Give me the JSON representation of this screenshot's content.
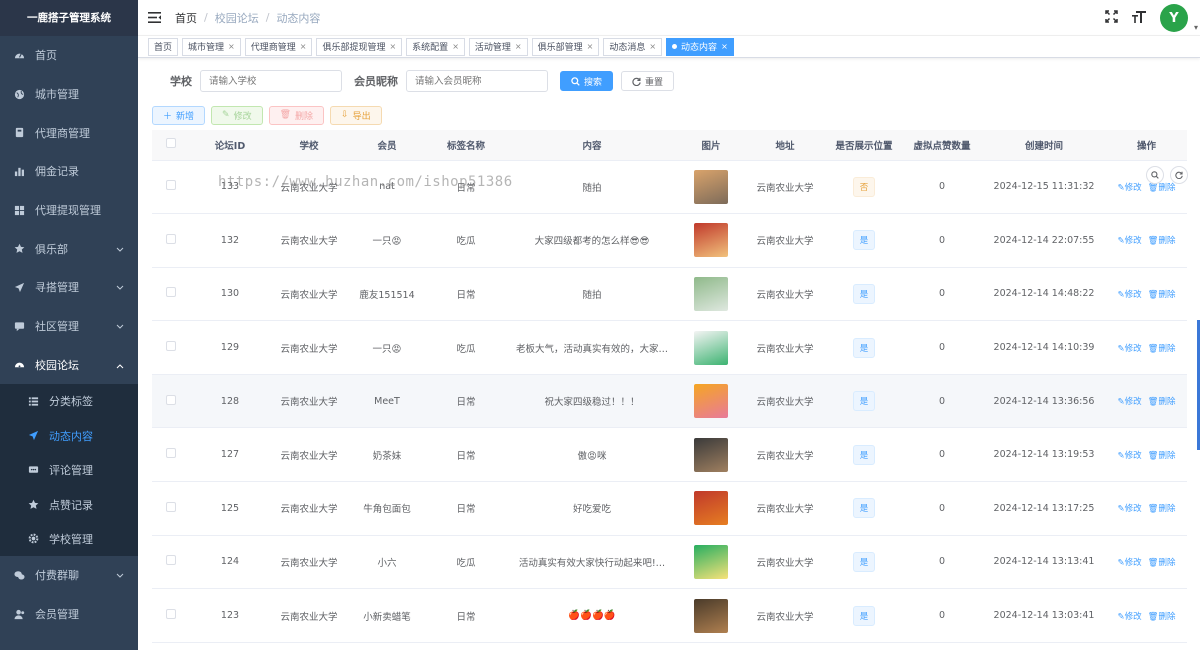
{
  "sidebar": {
    "logo": "一鹿搭子管理系统",
    "items": [
      {
        "label": "首页",
        "icon": "dashboard-icon"
      },
      {
        "label": "城市管理",
        "icon": "globe-icon"
      },
      {
        "label": "代理商管理",
        "icon": "agent-icon"
      },
      {
        "label": "佣金记录",
        "icon": "bar-chart-icon"
      },
      {
        "label": "代理提现管理",
        "icon": "grid-icon"
      },
      {
        "label": "俱乐部",
        "icon": "star-icon",
        "arrow": "down"
      },
      {
        "label": "寻搭管理",
        "icon": "send-icon",
        "arrow": "down"
      },
      {
        "label": "社区管理",
        "icon": "chat-icon",
        "arrow": "down"
      },
      {
        "label": "校园论坛",
        "icon": "forum-icon",
        "arrow": "up",
        "open": true
      }
    ],
    "sub_items": [
      {
        "label": "分类标签",
        "icon": "list-icon"
      },
      {
        "label": "动态内容",
        "icon": "send-icon",
        "active": true
      },
      {
        "label": "评论管理",
        "icon": "comment-icon"
      },
      {
        "label": "点赞记录",
        "icon": "star-icon"
      },
      {
        "label": "学校管理",
        "icon": "gear-icon"
      }
    ],
    "bottom_items": [
      {
        "label": "付费群聊",
        "icon": "wechat-icon",
        "arrow": "down"
      },
      {
        "label": "会员管理",
        "icon": "user-icon"
      }
    ]
  },
  "breadcrumb": [
    "首页",
    "校园论坛",
    "动态内容"
  ],
  "avatar_text": "Y",
  "tabs": [
    {
      "label": "首页",
      "closable": false
    },
    {
      "label": "城市管理",
      "closable": true
    },
    {
      "label": "代理商管理",
      "closable": true
    },
    {
      "label": "俱乐部提现管理",
      "closable": true
    },
    {
      "label": "系统配置",
      "closable": true
    },
    {
      "label": "活动管理",
      "closable": true
    },
    {
      "label": "俱乐部管理",
      "closable": true
    },
    {
      "label": "动态消息",
      "closable": true
    },
    {
      "label": "动态内容",
      "closable": true,
      "active": true
    }
  ],
  "search": {
    "school_label": "学校",
    "school_placeholder": "请输入学校",
    "nick_label": "会员昵称",
    "nick_placeholder": "请输入会员昵称",
    "search_btn": "搜索",
    "reset_btn": "重置"
  },
  "toolbar": {
    "add": "新增",
    "edit": "修改",
    "delete": "删除",
    "export": "导出"
  },
  "watermark": "https://www.huzhan.com/ishop51386",
  "table": {
    "headers": [
      "论坛ID",
      "学校",
      "会员",
      "标签名称",
      "内容",
      "图片",
      "地址",
      "是否展示位置",
      "虚拟点赞数量",
      "创建时间",
      "操作"
    ],
    "rows": [
      {
        "id": "133",
        "school": "云南农业大学",
        "member": "nat",
        "tag": "日常",
        "content": "随拍",
        "img": [
          "#d9a36b",
          "#7d6b5a"
        ],
        "address": "云南农业大学",
        "show": "否",
        "likes": "0",
        "time": "2024-12-15 11:31:32"
      },
      {
        "id": "132",
        "school": "云南农业大学",
        "member": "一只😡",
        "tag": "吃瓜",
        "content": "大家四级都考的怎么样😎😎",
        "img": [
          "#c0392b",
          "#f1c27d"
        ],
        "address": "云南农业大学",
        "show": "是",
        "likes": "0",
        "time": "2024-12-14 22:07:55"
      },
      {
        "id": "130",
        "school": "云南农业大学",
        "member": "鹿友151514",
        "tag": "日常",
        "content": "随拍",
        "img": [
          "#8fb98a",
          "#dfe8e0"
        ],
        "address": "云南农业大学",
        "show": "是",
        "likes": "0",
        "time": "2024-12-14 14:48:22"
      },
      {
        "id": "129",
        "school": "云南农业大学",
        "member": "一只😡",
        "tag": "吃瓜",
        "content": "老板大气，活动真实有效的，大家…",
        "img": [
          "#f4f4f4",
          "#3cb371"
        ],
        "address": "云南农业大学",
        "show": "是",
        "likes": "0",
        "time": "2024-12-14 14:10:39"
      },
      {
        "id": "128",
        "school": "云南农业大学",
        "member": "MeeT",
        "tag": "日常",
        "content": "祝大家四级稳过！！！",
        "img": [
          "#f5a623",
          "#e87a9a"
        ],
        "address": "云南农业大学",
        "show": "是",
        "likes": "0",
        "time": "2024-12-14 13:36:56",
        "highlight": true
      },
      {
        "id": "127",
        "school": "云南农业大学",
        "member": "奶茶妹",
        "tag": "日常",
        "content": "傲😡咪",
        "img": [
          "#3a3a3a",
          "#a08060"
        ],
        "address": "云南农业大学",
        "show": "是",
        "likes": "0",
        "time": "2024-12-14 13:19:53"
      },
      {
        "id": "125",
        "school": "云南农业大学",
        "member": "牛角包面包",
        "tag": "日常",
        "content": "好吃爱吃",
        "img": [
          "#c0392b",
          "#e67e22"
        ],
        "address": "云南农业大学",
        "show": "是",
        "likes": "0",
        "time": "2024-12-14 13:17:25"
      },
      {
        "id": "124",
        "school": "云南农业大学",
        "member": "小六",
        "tag": "吃瓜",
        "content": "活动真实有效大家快行动起来吧!…",
        "img": [
          "#27ae60",
          "#f7e27a"
        ],
        "address": "云南农业大学",
        "show": "是",
        "likes": "0",
        "time": "2024-12-14 13:13:41"
      },
      {
        "id": "123",
        "school": "云南农业大学",
        "member": "小新卖蜡笔",
        "tag": "日常",
        "content": "🍎🍎🍎🍎",
        "img": [
          "#4a3b2a",
          "#b08050"
        ],
        "address": "云南农业大学",
        "show": "是",
        "likes": "0",
        "time": "2024-12-14 13:03:41"
      }
    ],
    "op_edit": "修改",
    "op_delete": "删除"
  },
  "colors": {
    "sidebar_bg": "#304156",
    "primary": "#409eff",
    "active_menu": "#409eff"
  }
}
